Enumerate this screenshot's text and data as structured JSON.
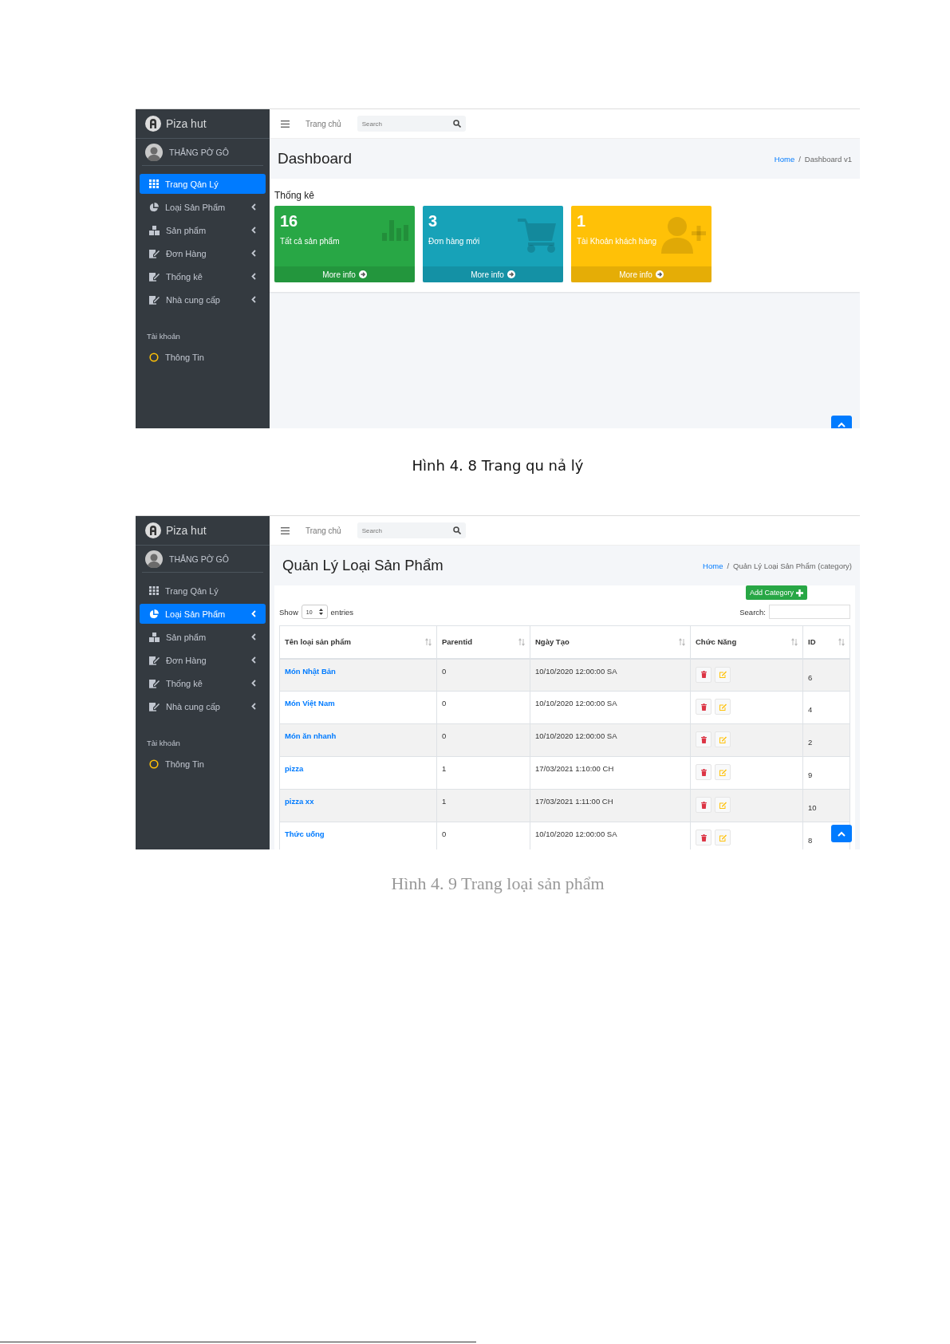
{
  "figures": [
    {
      "screen": {
        "brand": "Piza hut",
        "user": "THẮNG PỜ GÔ",
        "nav": [
          {
            "label": "Trang Qản Lý",
            "selected": true,
            "expandable": false
          },
          {
            "label": "Loại Sản Phẩm",
            "selected": false,
            "expandable": true
          },
          {
            "label": "Sản phẩm",
            "selected": false,
            "expandable": true
          },
          {
            "label": "Đơn Hàng",
            "selected": false,
            "expandable": true
          },
          {
            "label": "Thống kê",
            "selected": false,
            "expandable": true
          },
          {
            "label": "Nhà cung cấp",
            "selected": false,
            "expandable": true
          }
        ],
        "section": "Tài khoản",
        "account": [
          {
            "label": "Thông Tin"
          }
        ],
        "topbar": {
          "link": "Trang chủ",
          "search": {
            "placeholder": "Search"
          }
        },
        "title": "Dashboard",
        "breadcrumb": [
          {
            "kind": "link",
            "label": "Home"
          },
          {
            "kind": "separator",
            "label": "/"
          },
          {
            "kind": "current",
            "label": "Dashboard v1"
          }
        ],
        "content": {
          "kind": "dashboard",
          "heading": "Thống kê",
          "boxes": [
            {
              "value": "16",
              "label": "Tất cả sản phẩm",
              "footer": "More info",
              "color": "#28a745"
            },
            {
              "value": "3",
              "label": "Đơn hàng mới",
              "footer": "More info",
              "color": "#17a2b8"
            },
            {
              "value": "1",
              "label": "Tài Khoản khách hàng",
              "footer": "More info",
              "color": "#ffc107"
            }
          ]
        }
      },
      "caption": "Hình 4. 8 Trang qu nả lý"
    },
    {
      "screen": {
        "brand": "Piza hut",
        "user": "THẮNG PỜ GÔ",
        "nav": [
          {
            "label": "Trang Qản Lý",
            "selected": false,
            "expandable": false
          },
          {
            "label": "Loại Sản Phẩm",
            "selected": true,
            "expandable": true
          },
          {
            "label": "Sản phẩm",
            "selected": false,
            "expandable": true
          },
          {
            "label": "Đơn Hàng",
            "selected": false,
            "expandable": true
          },
          {
            "label": "Thống kê",
            "selected": false,
            "expandable": true
          },
          {
            "label": "Nhà cung cấp",
            "selected": false,
            "expandable": true
          }
        ],
        "section": "Tài khoản",
        "account": [
          {
            "label": "Thông Tin"
          }
        ],
        "topbar": {
          "link": "Trang chủ",
          "search": {
            "placeholder": "Search"
          }
        },
        "title": "Quản Lý Loại Sản Phẩm",
        "breadcrumb": [
          {
            "kind": "link",
            "label": "Home"
          },
          {
            "kind": "separator",
            "label": "/"
          },
          {
            "kind": "current",
            "label": "Quản Lý Loại Sản Phẩm (category)"
          }
        ],
        "content": {
          "kind": "table",
          "add_button": "Add Category",
          "show_label": "Show",
          "show_value": "10",
          "entries_label": "entries",
          "search_label": "Search:",
          "columns": [
            "Tên loại sản phẩm",
            "Parentid",
            "Ngày Tạo",
            "Chức Năng",
            "ID"
          ],
          "rows": [
            {
              "name": "Món Nhật Bản",
              "parentid": "0",
              "created": "10/10/2020 12:00:00 SA",
              "id": "6"
            },
            {
              "name": "Món Việt Nam",
              "parentid": "0",
              "created": "10/10/2020 12:00:00 SA",
              "id": "4"
            },
            {
              "name": "Món ăn nhanh",
              "parentid": "0",
              "created": "10/10/2020 12:00:00 SA",
              "id": "2"
            },
            {
              "name": "pizza",
              "parentid": "1",
              "created": "17/03/2021 1:10:00 CH",
              "id": "9"
            },
            {
              "name": "pizza xx",
              "parentid": "1",
              "created": "17/03/2021 1:11:00 CH",
              "id": "10"
            },
            {
              "name": "Thức uống",
              "parentid": "0",
              "created": "10/10/2020 12:00:00 SA",
              "id": "8"
            }
          ]
        }
      },
      "caption": "Hình 4. 9 Trang loại sản phẩm"
    }
  ]
}
